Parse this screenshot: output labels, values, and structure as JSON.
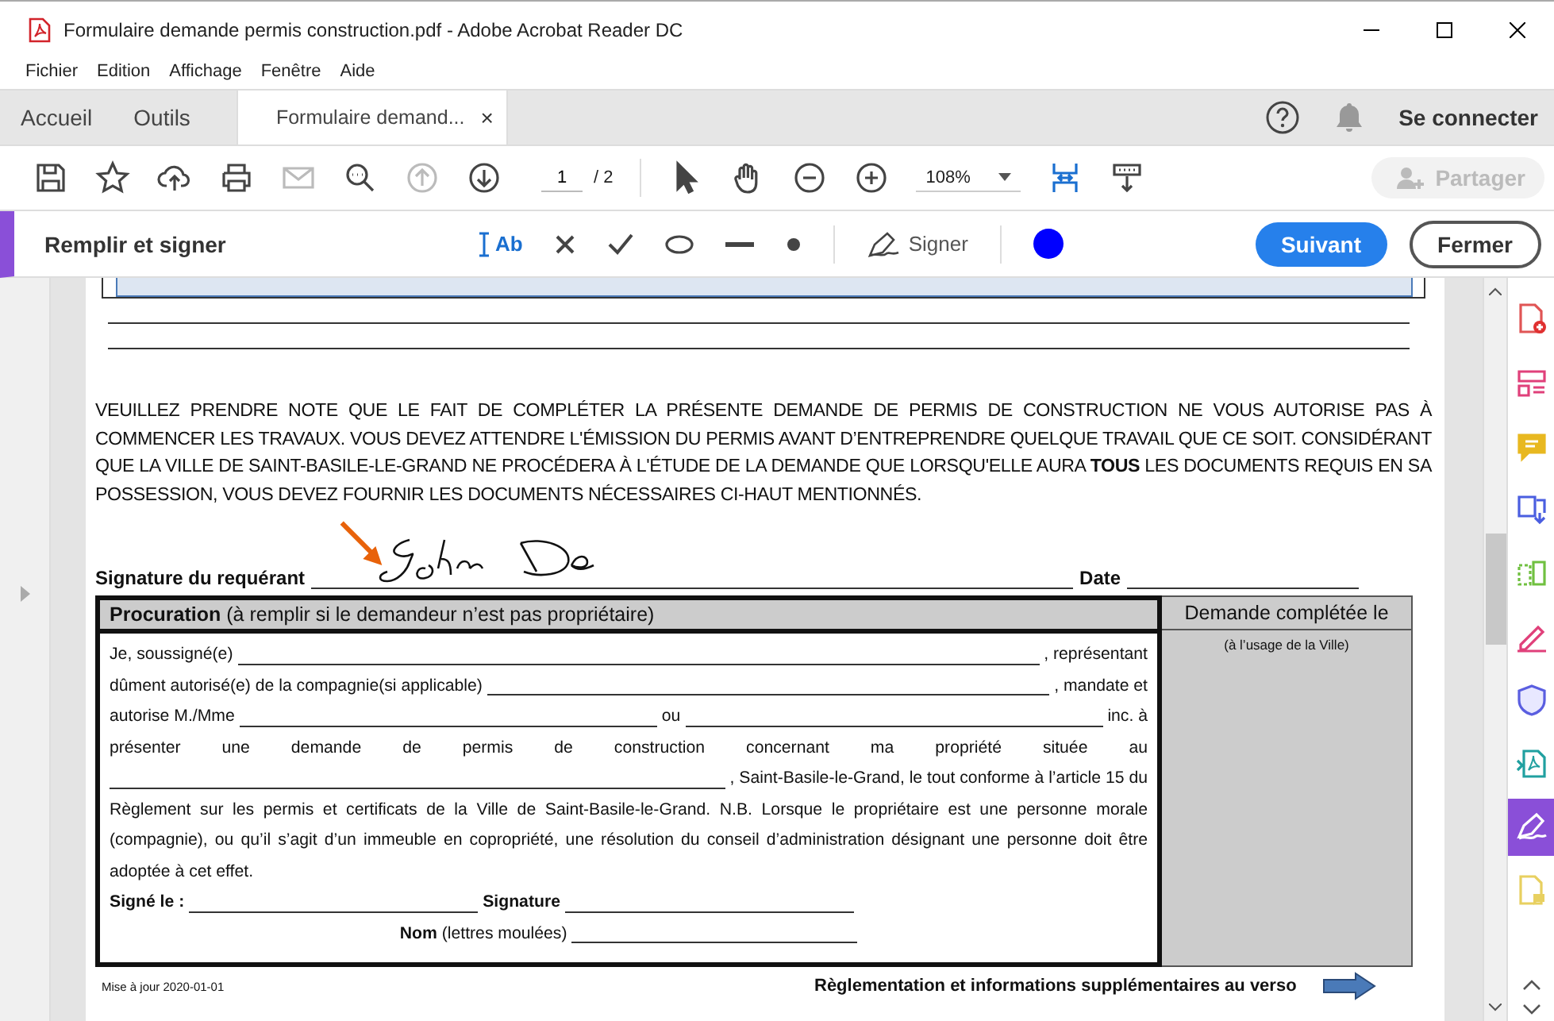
{
  "window": {
    "title": "Formulaire demande permis construction.pdf - Adobe Acrobat Reader DC"
  },
  "menu": [
    "Fichier",
    "Edition",
    "Affichage",
    "Fenêtre",
    "Aide"
  ],
  "tabs": [
    {
      "label": "Accueil",
      "selected": false
    },
    {
      "label": "Outils",
      "selected": false
    },
    {
      "label": "Formulaire demand...",
      "selected": true,
      "close_glyph": "×"
    }
  ],
  "account": {
    "label": "Se connecter"
  },
  "toolbar": {
    "tools_left": [
      {
        "kind": "save",
        "disabled": false
      },
      {
        "kind": "star",
        "disabled": false
      },
      {
        "kind": "upload",
        "disabled": false
      },
      {
        "kind": "print",
        "disabled": false
      },
      {
        "kind": "mail",
        "disabled": true
      },
      {
        "kind": "find",
        "disabled": false
      },
      {
        "kind": "prev",
        "disabled": true
      },
      {
        "kind": "next",
        "disabled": false
      }
    ],
    "page": {
      "value": "1",
      "total": "/ 2"
    },
    "tools_mid": [
      {
        "kind": "pointer",
        "disabled": false
      },
      {
        "kind": "hand",
        "disabled": false
      },
      {
        "kind": "zoom-out",
        "disabled": false
      },
      {
        "kind": "zoom-in",
        "disabled": false
      }
    ],
    "zoom": {
      "value": "108%"
    },
    "tools_right": [
      {
        "kind": "fit",
        "disabled": false
      },
      {
        "kind": "read",
        "disabled": false
      }
    ],
    "share": {
      "label": "Partager",
      "disabled": true
    }
  },
  "fill_sign": {
    "title": "Remplir et signer",
    "tools": [
      {
        "kind": "text",
        "label": "Ab"
      },
      {
        "kind": "cross"
      },
      {
        "kind": "check"
      },
      {
        "kind": "ellipse"
      },
      {
        "kind": "line"
      },
      {
        "kind": "dot"
      }
    ],
    "sign": {
      "label": "Signer"
    },
    "color": "#0000ff",
    "next": {
      "label": "Suivant"
    },
    "close": {
      "label": "Fermer"
    }
  },
  "document": {
    "notice": "VEUILLEZ PRENDRE NOTE QUE LE FAIT DE COMPLÉTER LA PRÉSENTE DEMANDE DE PERMIS DE CONSTRUCTION NE VOUS AUTORISE PAS À COMMENCER LES TRAVAUX. VOUS DEVEZ ATTENDRE L'ÉMISSION DU PERMIS AVANT D’ENTREPRENDRE QUELQUE TRAVAIL QUE CE SOIT. CONSIDÉRANT QUE LA VILLE DE SAINT-BASILE-LE-GRAND NE PROCÉDERA À L'ÉTUDE DE LA DEMANDE QUE LORSQU'ELLE AURA **TOUS** LES DOCUMENTS REQUIS EN SA POSSESSION, VOUS DEVEZ FOURNIR LES DOCUMENTS NÉCESSAIRES CI-HAUT MENTIONNÉS.",
    "signature_label": "Signature du requérant",
    "date_label": "Date",
    "procuration_title": "**Procuration** (à remplir si le demandeur n’est pas propriétaire)",
    "side_title": "Demande complétée le",
    "side_note": "(à l’usage de la Ville)",
    "lines": [
      {
        "kind": "fill",
        "parts": [
          {
            "kind": "text",
            "text": "Je, soussigné(e)"
          },
          {
            "kind": "blank"
          },
          {
            "kind": "text",
            "text": ", représentant"
          }
        ]
      },
      {
        "kind": "fill",
        "parts": [
          {
            "kind": "text",
            "text": "dûment autorisé(e) de la compagnie(si applicable)"
          },
          {
            "kind": "blank"
          },
          {
            "kind": "text",
            "text": ", mandate et"
          }
        ]
      },
      {
        "kind": "fill",
        "parts": [
          {
            "kind": "text",
            "text": "autorise M./Mme"
          },
          {
            "kind": "blank"
          },
          {
            "kind": "text",
            "text": "ou"
          },
          {
            "kind": "blank"
          },
          {
            "kind": "text",
            "text": "inc. à"
          }
        ]
      },
      {
        "kind": "justified",
        "text": "présenter une demande de permis de construction concernant ma propriété située au"
      },
      {
        "kind": "fill",
        "parts": [
          {
            "kind": "blank"
          },
          {
            "kind": "text",
            "text": ", Saint-Basile-le-Grand, le tout conforme à l’article 15 du"
          }
        ]
      },
      {
        "kind": "paragraph",
        "text": "Règlement sur les permis et certificats de la Ville de Saint-Basile-le-Grand. N.B. Lorsque le propriétaire est une personne morale (compagnie), ou qu’il s’agit d’un immeuble en copropriété, une résolution du conseil d’administration désignant une personne doit être adoptée à cet effet."
      },
      {
        "kind": "fill",
        "parts": [
          {
            "kind": "text",
            "text": "**Signé le :**"
          },
          {
            "kind": "blank"
          },
          {
            "kind": "text",
            "text": "**Signature**"
          },
          {
            "kind": "blank"
          },
          {
            "kind": "gap"
          }
        ]
      },
      {
        "kind": "fill",
        "parts": [
          {
            "kind": "gap"
          },
          {
            "kind": "text",
            "text": "**Nom** (lettres moulées)"
          },
          {
            "kind": "blank"
          },
          {
            "kind": "gap"
          }
        ]
      }
    ],
    "updated": "Mise à jour 2020-01-01",
    "verso": "Règlementation et informations supplémentaires au verso"
  },
  "side_tools": [
    {
      "kind": "create",
      "selected": false
    },
    {
      "kind": "organize",
      "selected": false
    },
    {
      "kind": "comment",
      "selected": false
    },
    {
      "kind": "export",
      "selected": false
    },
    {
      "kind": "compress",
      "selected": false
    },
    {
      "kind": "edit",
      "selected": false
    },
    {
      "kind": "protect",
      "selected": false
    },
    {
      "kind": "send",
      "selected": false
    },
    {
      "kind": "sign",
      "selected": true
    },
    {
      "kind": "review",
      "selected": false
    }
  ]
}
